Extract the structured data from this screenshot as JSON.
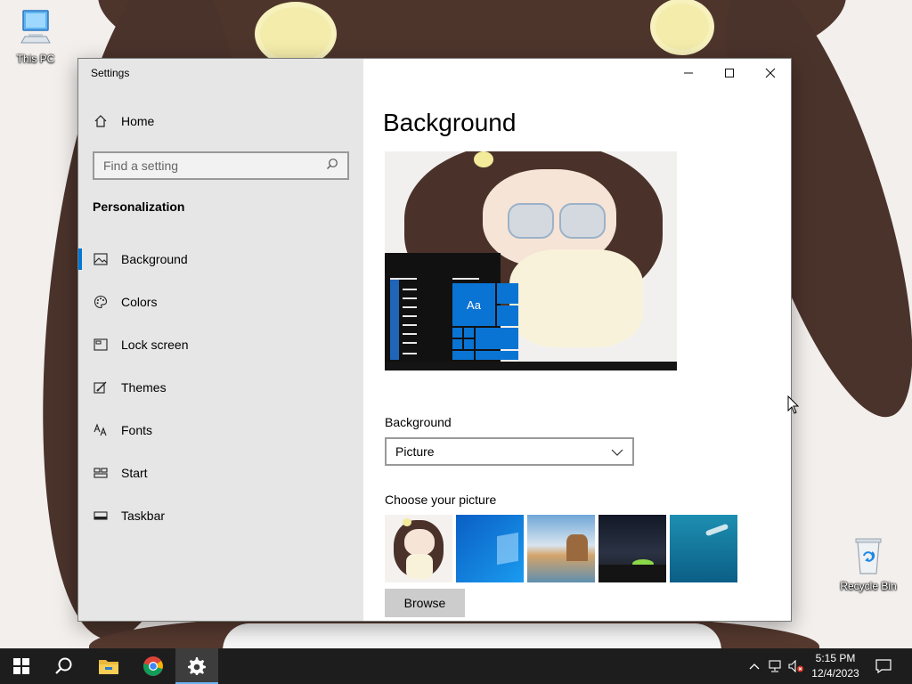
{
  "desktop": {
    "icons": [
      {
        "label": "This PC",
        "icon": "this-pc-icon"
      },
      {
        "label": "Recycle Bin",
        "icon": "recycle-bin-icon"
      }
    ]
  },
  "window": {
    "title": "Settings",
    "controls": {
      "minimize": "minimize-icon",
      "maximize": "maximize-icon",
      "close": "close-icon"
    }
  },
  "sidebar": {
    "home_label": "Home",
    "search_placeholder": "Find a setting",
    "section_title": "Personalization",
    "items": [
      {
        "label": "Background",
        "icon": "picture-icon",
        "active": true
      },
      {
        "label": "Colors",
        "icon": "palette-icon",
        "active": false
      },
      {
        "label": "Lock screen",
        "icon": "lock-screen-icon",
        "active": false
      },
      {
        "label": "Themes",
        "icon": "themes-icon",
        "active": false
      },
      {
        "label": "Fonts",
        "icon": "fonts-icon",
        "active": false
      },
      {
        "label": "Start",
        "icon": "start-icon",
        "active": false
      },
      {
        "label": "Taskbar",
        "icon": "taskbar-icon",
        "active": false
      }
    ]
  },
  "main": {
    "title": "Background",
    "preview": {
      "tile_text": "Aa"
    },
    "background_label": "Background",
    "background_value": "Picture",
    "choose_label": "Choose your picture",
    "browse_label": "Browse"
  },
  "taskbar": {
    "apps": [
      "start-button",
      "search-icon",
      "file-explorer-icon",
      "chrome-icon",
      "settings-icon"
    ],
    "active_app": "settings-icon",
    "time": "5:15 PM",
    "date": "12/4/2023"
  },
  "colors": {
    "accent": "#0078d7",
    "sidebar_bg": "#e6e6e6",
    "taskbar_bg": "#1d1d1d",
    "tile_blue": "#0a74d4"
  }
}
